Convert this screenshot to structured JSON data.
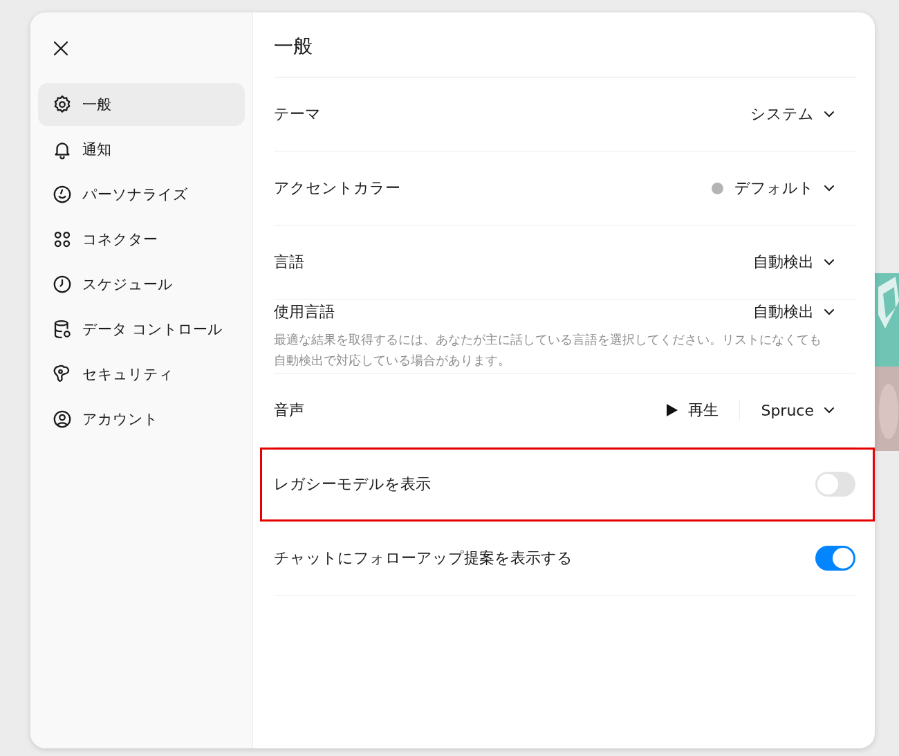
{
  "sidebar": {
    "items": [
      {
        "label": "一般",
        "selected": true
      },
      {
        "label": "通知",
        "selected": false
      },
      {
        "label": "パーソナライズ",
        "selected": false
      },
      {
        "label": "コネクター",
        "selected": false
      },
      {
        "label": "スケジュール",
        "selected": false
      },
      {
        "label": "データ コントロール",
        "selected": false
      },
      {
        "label": "セキュリティ",
        "selected": false
      },
      {
        "label": "アカウント",
        "selected": false
      }
    ]
  },
  "panel": {
    "title": "一般",
    "settings": [
      {
        "kind": "select",
        "label": "テーマ",
        "value": "システム"
      },
      {
        "kind": "color-select",
        "label": "アクセントカラー",
        "value": "デフォルト"
      },
      {
        "kind": "select",
        "label": "言語",
        "value": "自動検出"
      },
      {
        "kind": "select",
        "label": "使用言語",
        "value": "自動検出",
        "description": "最適な結果を取得するには、あなたが主に話している言語を選択してください。リストになくても自動検出で対応している場合があります。"
      },
      {
        "kind": "voice",
        "label": "音声",
        "play": "再生",
        "value": "Spruce"
      },
      {
        "kind": "toggle",
        "label": "レガシーモデルを表示",
        "on": false,
        "highlighted": true
      },
      {
        "kind": "toggle",
        "label": "チャットにフォローアップ提案を表示する",
        "on": true,
        "highlighted": false
      }
    ]
  }
}
